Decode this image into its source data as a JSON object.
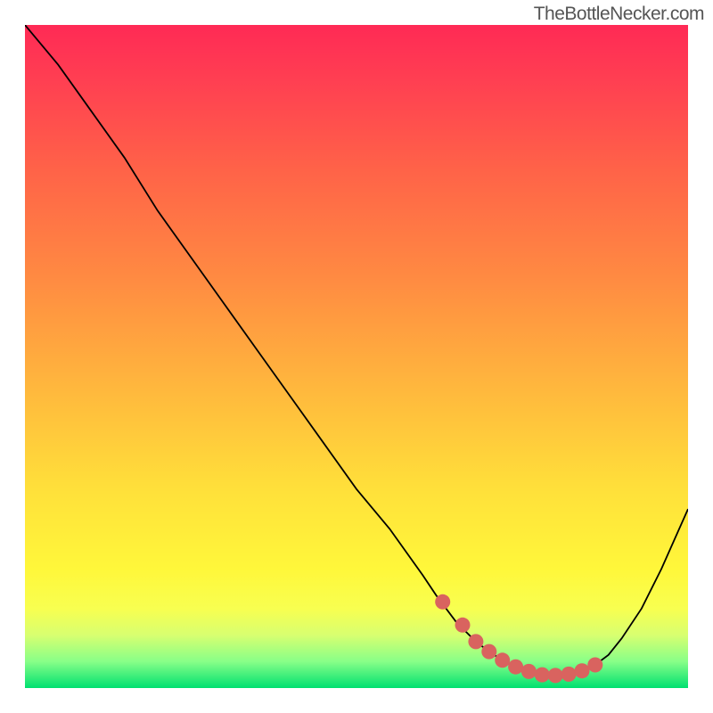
{
  "watermark": "TheBottleNecker.com",
  "chart_data": {
    "type": "line",
    "title": "",
    "xlabel": "",
    "ylabel": "",
    "xlim": [
      0,
      100
    ],
    "ylim": [
      0,
      100
    ],
    "series": [
      {
        "name": "curve",
        "x": [
          0,
          5,
          10,
          15,
          20,
          25,
          30,
          35,
          40,
          45,
          50,
          55,
          60,
          62,
          65,
          68,
          70,
          72,
          74,
          76,
          78,
          80,
          82,
          84,
          86,
          88,
          90,
          93,
          96,
          100
        ],
        "y": [
          100,
          94,
          87,
          80,
          72,
          65,
          58,
          51,
          44,
          37,
          30,
          24,
          17,
          14,
          10,
          7,
          5.5,
          4.2,
          3.2,
          2.5,
          2.0,
          1.9,
          2.1,
          2.6,
          3.5,
          5.0,
          7.5,
          12,
          18,
          27
        ]
      }
    ],
    "markers": {
      "name": "bottleneck-region",
      "x": [
        63,
        66,
        68,
        70,
        72,
        74,
        76,
        78,
        80,
        82,
        84,
        86
      ],
      "y": [
        13,
        9.5,
        7.0,
        5.5,
        4.2,
        3.2,
        2.5,
        2.0,
        1.9,
        2.1,
        2.6,
        3.5
      ],
      "color": "#d9635f"
    },
    "background": {
      "type": "vertical-gradient",
      "top": "#ff2a55",
      "bottom": "#00e070"
    }
  }
}
